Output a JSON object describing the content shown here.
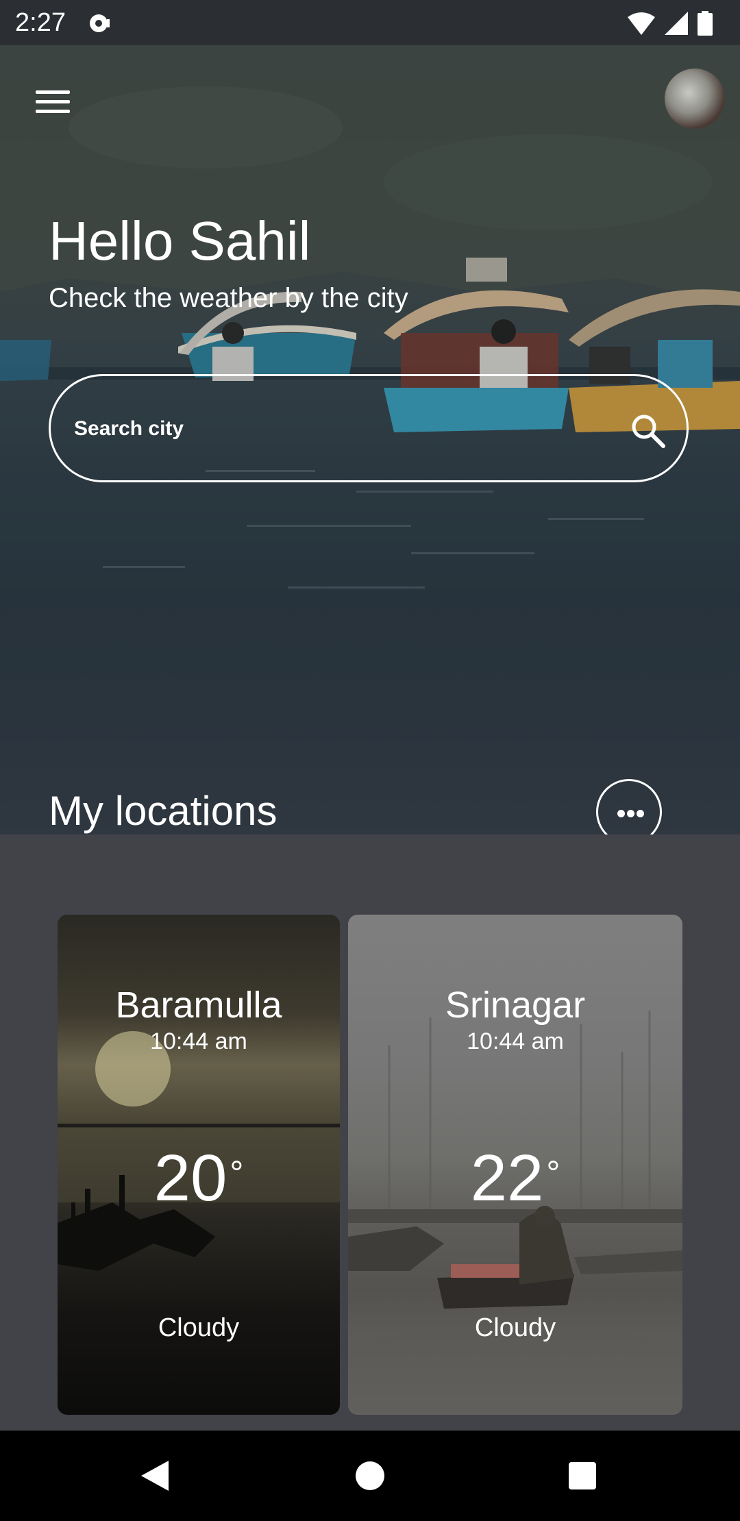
{
  "status_bar": {
    "time": "2:27",
    "icons": [
      "notification-icon",
      "wifi-icon",
      "signal-icon",
      "battery-icon"
    ]
  },
  "header": {
    "menu_icon": "menu-icon",
    "avatar_icon": "user-avatar"
  },
  "hero": {
    "greeting": "Hello Sahil",
    "subtitle": "Check the weather by the city",
    "search": {
      "placeholder": "Search city",
      "value": "",
      "icon": "search-icon"
    }
  },
  "locations": {
    "title": "My locations",
    "more_icon": "more-horizontal-icon",
    "cards": [
      {
        "city": "Baramulla",
        "time": "10:44 am",
        "temp": "20",
        "degree": "°",
        "condition": "Cloudy"
      },
      {
        "city": "Srinagar",
        "time": "10:44 am",
        "temp": "22",
        "degree": "°",
        "condition": "Cloudy"
      }
    ]
  },
  "nav_bar": {
    "icons": [
      "back-icon",
      "home-icon",
      "recents-icon"
    ]
  },
  "colors": {
    "panel_bg": "#424249",
    "status_bar_bg": "#2b2f33",
    "text": "#ffffff"
  }
}
